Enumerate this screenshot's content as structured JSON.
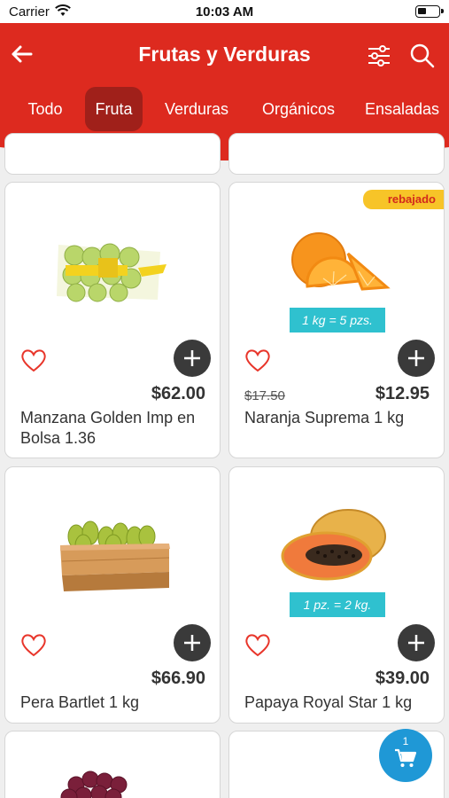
{
  "status_bar": {
    "carrier": "Carrier",
    "time": "10:03 AM"
  },
  "header": {
    "title": "Frutas y Verduras",
    "color": "#dd2a1f"
  },
  "tabs": [
    {
      "label": "Todo",
      "active": false
    },
    {
      "label": "Fruta",
      "active": true
    },
    {
      "label": "Verduras",
      "active": false
    },
    {
      "label": "Orgánicos",
      "active": false
    },
    {
      "label": "Ensaladas",
      "active": false
    }
  ],
  "products": [
    {
      "name": "Manzana Golden Imp en Bolsa 1.36",
      "price": "$62.00",
      "image": "apple-bag-image"
    },
    {
      "name": "Naranja Suprema 1 kg",
      "price": "$12.95",
      "old_price": "$17.50",
      "badge": "rebajado",
      "unit_note": "1 kg = 5 pzs.",
      "image": "orange-image"
    },
    {
      "name": "Pera Bartlet 1 kg",
      "price": "$66.90",
      "image": "pears-crate-image"
    },
    {
      "name": "Papaya Royal Star 1 kg",
      "price": "$39.00",
      "unit_note": "1 pz. = 2 kg.",
      "image": "papaya-image"
    }
  ],
  "cart": {
    "count": "1"
  },
  "colors": {
    "sale_badge": "#f7c428",
    "unit_pill": "#2fc1cf",
    "cart_fab": "#1f98d6",
    "active_tab": "#a0201a"
  }
}
